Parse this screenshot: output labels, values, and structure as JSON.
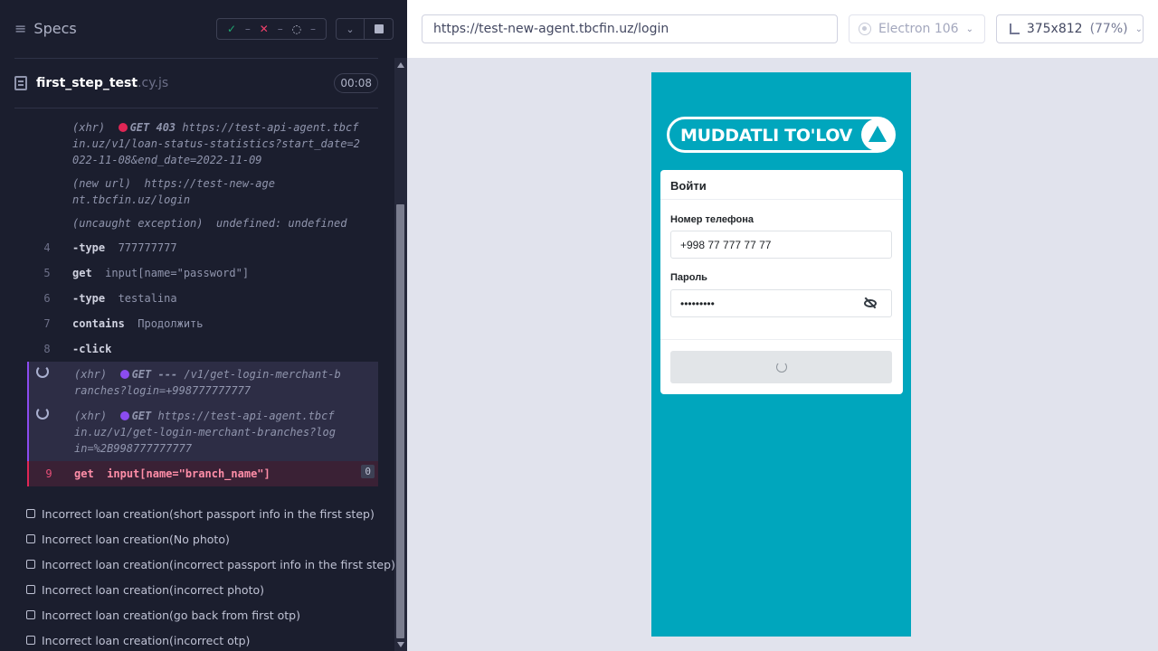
{
  "runner": {
    "header": {
      "title": "Specs",
      "passed": "–",
      "failed": "–",
      "pending": "–"
    },
    "spec": {
      "name": "first_step_test",
      "ext": ".cy.js",
      "duration": "00:08"
    },
    "log": {
      "xhr_prefix": "(xhr)",
      "row1": {
        "method": "GET 403",
        "url": "https://test-api-agent.tbcfin.uz/v1/loan-status-statistics?start_date=2022-11-08&end_date=2022-11-09"
      },
      "row2": {
        "label": "(new url)",
        "url": "https://test-new-agent.tbcfin.uz/login"
      },
      "row3": {
        "label": "(uncaught exception)",
        "message": "undefined: undefined"
      },
      "cmd4": {
        "num": "4",
        "cmd": "-type",
        "arg": "777777777"
      },
      "cmd5": {
        "num": "5",
        "cmd": "get",
        "arg": "input[name=\"password\"]"
      },
      "cmd6": {
        "num": "6",
        "cmd": "-type",
        "arg": "testalina"
      },
      "cmd7": {
        "num": "7",
        "cmd": "contains",
        "arg": "Продолжить"
      },
      "cmd8": {
        "num": "8",
        "cmd": "-click",
        "arg": ""
      },
      "pend1": {
        "method": "GET ---",
        "url": "/v1/get-login-merchant-branches?login=+998777777777"
      },
      "pend2": {
        "method": "GET",
        "url": "https://test-api-agent.tbcfin.uz/v1/get-login-merchant-branches?login=%2B998777777777"
      },
      "cmd9": {
        "num": "9",
        "cmd": "get",
        "arg": "input[name=\"branch_name\"]",
        "badge": "0"
      }
    },
    "tests": [
      "Incorrect loan creation(short passport info in the first step)",
      "Incorrect loan creation(No photo)",
      "Incorrect loan creation(incorrect passport info in the first step)",
      "Incorrect loan creation(incorrect photo)",
      "Incorrect loan creation(go back from first otp)",
      "Incorrect loan creation(incorrect otp)"
    ]
  },
  "topbar": {
    "url": "https://test-new-agent.tbcfin.uz/login",
    "browser": "Electron 106",
    "viewport": "375x812",
    "scale": "(77%)"
  },
  "app": {
    "logo_text": "MUDDATLI TO'LOV",
    "card_title": "Войти",
    "phone_label": "Номер телефона",
    "phone_value": "+998 77 777 77 77",
    "password_label": "Пароль",
    "password_value": "•••••••••"
  },
  "colors": {
    "runner_bg": "#1b1e2e",
    "app_bg": "#00a6bd",
    "fail": "#e02655",
    "pending": "#8b4cf0",
    "pass": "#1fa971"
  }
}
